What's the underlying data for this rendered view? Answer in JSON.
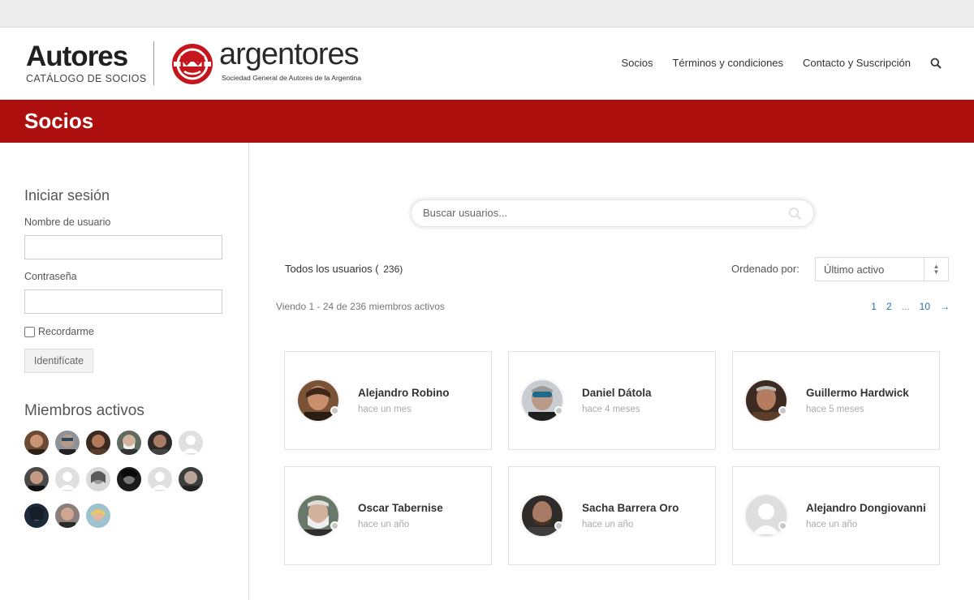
{
  "brand": {
    "autores_word": "Autores",
    "autores_sub": "CATÁLOGO DE SOCIOS",
    "argentores_word": "argentores",
    "argentores_tag": "Sociedad General de Autores de la Argentina"
  },
  "nav": {
    "items": [
      "Socios",
      "Términos y condiciones",
      "Contacto y Suscripción"
    ],
    "search_icon": "search-icon"
  },
  "page_title": "Socios",
  "sidebar": {
    "login_heading": "Iniciar sesión",
    "username_label": "Nombre de usuario",
    "username_value": "",
    "password_label": "Contraseña",
    "password_value": "",
    "remember_label": "Recordarme",
    "remember_checked": false,
    "submit_label": "Identifícate",
    "active_heading": "Miembros activos",
    "active_member_count_shown": 15
  },
  "main": {
    "search_placeholder": "Buscar usuarios...",
    "filter_label": "Todos los usuarios (",
    "filter_count": "236)",
    "order_label": "Ordenado por:",
    "order_value": "Último activo",
    "viewing_text": "Viendo 1 - 24 de 236 miembros activos",
    "pagination": [
      "1",
      "2",
      "...",
      "10",
      "→"
    ],
    "members": [
      {
        "name": "Alejandro Robino",
        "when": "hace un mes"
      },
      {
        "name": "Daniel Dátola",
        "when": "hace 4 meses"
      },
      {
        "name": "Guillermo Hardwick",
        "when": "hace 5 meses"
      },
      {
        "name": "Oscar Tabernise",
        "when": "hace un año"
      },
      {
        "name": "Sacha Barrera Oro",
        "when": "hace un año"
      },
      {
        "name": "Alejandro Dongiovanni",
        "when": "hace un año"
      }
    ]
  },
  "colors": {
    "accent": "#ad0e0e",
    "link": "#2a6ea6",
    "status_dot": "#c7c7c7"
  }
}
